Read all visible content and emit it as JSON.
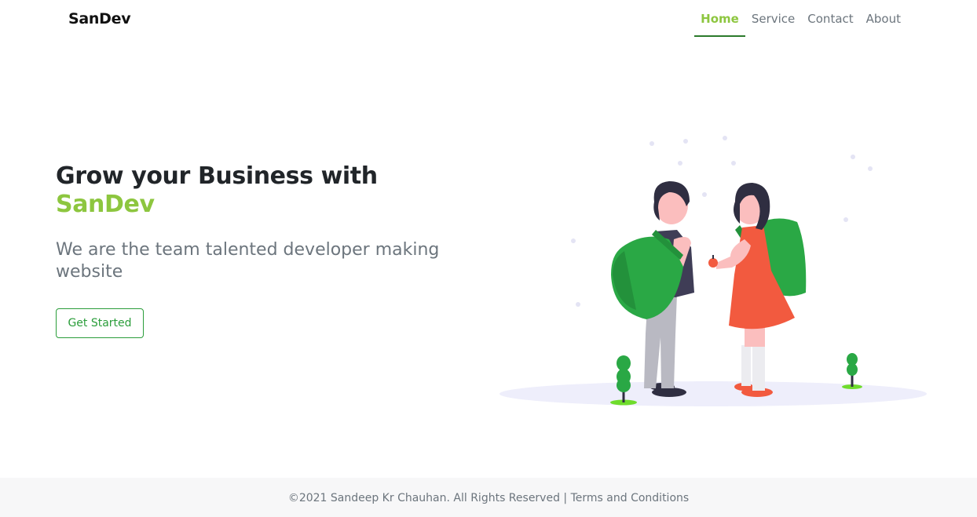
{
  "navbar": {
    "brand": "SanDev",
    "items": [
      {
        "label": "Home",
        "active": true
      },
      {
        "label": "Service"
      },
      {
        "label": "Contact"
      },
      {
        "label": "About"
      }
    ]
  },
  "hero": {
    "title": "Grow your Business with",
    "brand": "SanDev",
    "subtitle": "We are the team talented developer making website",
    "cta_label": "Get Started"
  },
  "footer": {
    "copyright": "©2021 Sandeep Kr Chauhan. All Rights Reserved",
    "separator": " | ",
    "terms_label": "Terms and Conditions"
  },
  "colors": {
    "brand_green": "#8dc63f",
    "button_green": "#2a9d3a",
    "muted_text": "#6c757d",
    "dark_text": "#212529"
  },
  "icons": [
    "students-illustration"
  ]
}
